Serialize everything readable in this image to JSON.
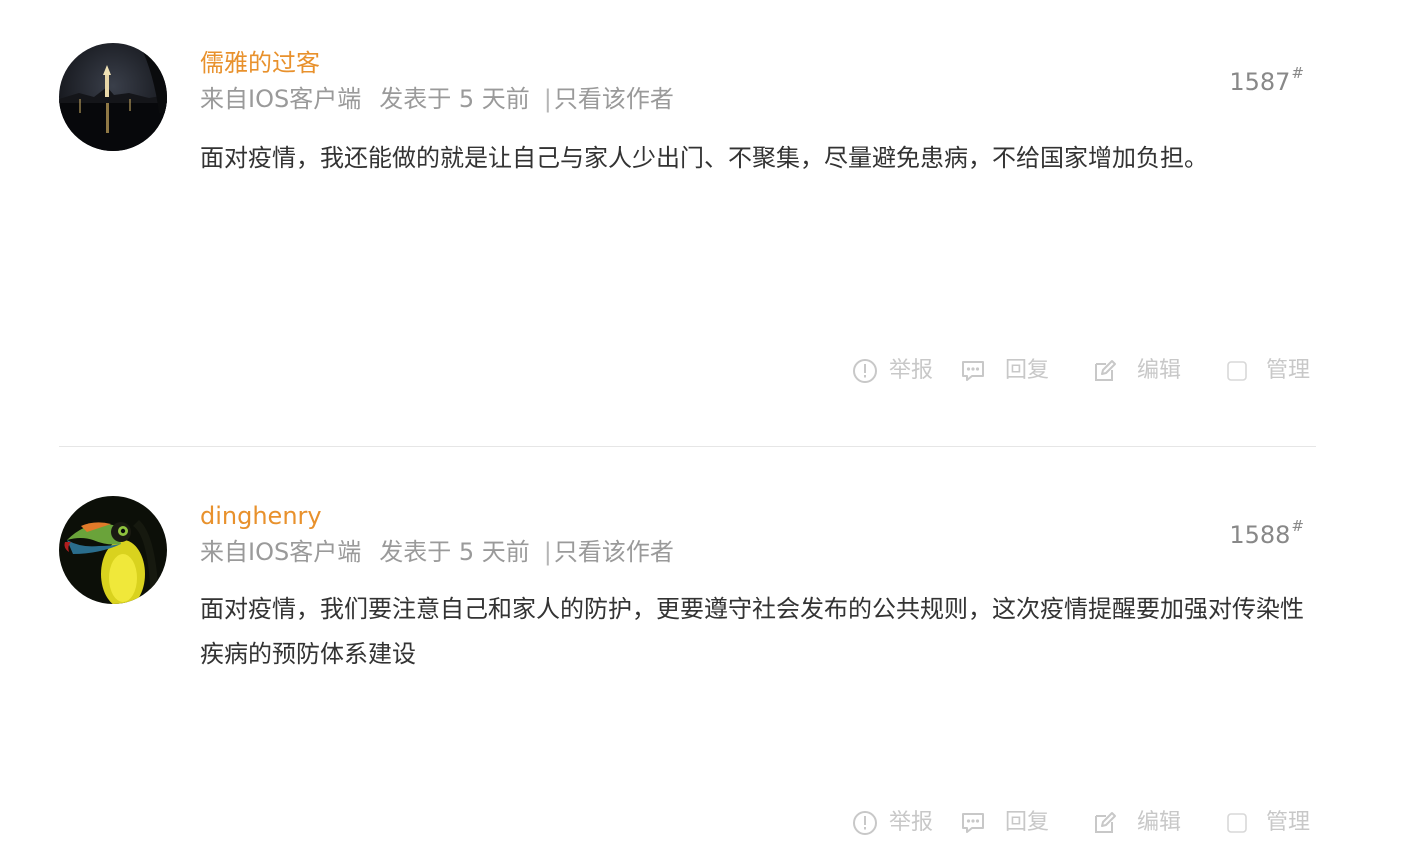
{
  "posts": [
    {
      "author": "儒雅的过客",
      "source": "来自IOS客户端",
      "posted": "发表于 5 天前",
      "separator": "|",
      "only_author": "只看该作者",
      "floor": "1587",
      "floor_mark": "#",
      "content": "面对疫情，我还能做的就是让自己与家人少出门、不聚集，尽量避免患病，不给国家增加负担。",
      "avatar_icon": "night-lake-avatar",
      "actions": {
        "report": "举报",
        "reply": "回复",
        "edit": "编辑",
        "manage": "管理"
      }
    },
    {
      "author": "dinghenry",
      "source": "来自IOS客户端",
      "posted": "发表于 5 天前",
      "separator": "|",
      "only_author": "只看该作者",
      "floor": "1588",
      "floor_mark": "#",
      "content": "面对疫情，我们要注意自己和家人的防护，更要遵守社会发布的公共规则，这次疫情提醒要加强对传染性疾病的预防体系建设",
      "avatar_icon": "toucan-avatar",
      "actions": {
        "report": "举报",
        "reply": "回复",
        "edit": "编辑",
        "manage": "管理"
      }
    }
  ],
  "colors": {
    "author": "#e8912c",
    "meta": "#9a9a9a",
    "content": "#333333",
    "action": "#c8c8c8",
    "divider": "#e6e6e6"
  }
}
